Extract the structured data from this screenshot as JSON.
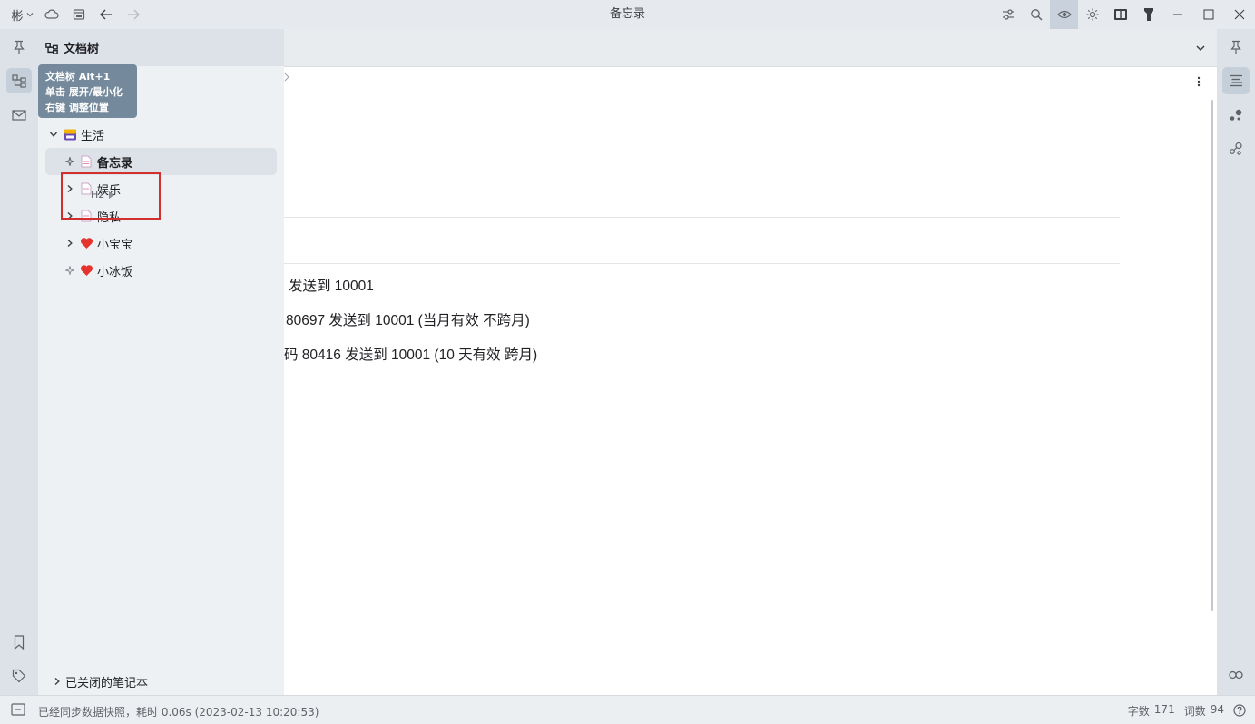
{
  "window": {
    "title": "备忘录",
    "workspace_label": "彬"
  },
  "tree": {
    "header": "文档树",
    "tooltip": [
      "文档树 Alt+1",
      "单击 展开/最小化",
      "右键 调整位置"
    ],
    "items": [
      {
        "label": "生活",
        "icon": "notebook-icon"
      },
      {
        "label": "备忘录",
        "icon": "document-icon",
        "selected": true
      },
      {
        "label": "娱乐",
        "icon": "document-icon"
      },
      {
        "label": "隐私",
        "icon": "document-icon"
      },
      {
        "label": "小宝宝",
        "icon": "heart-icon"
      },
      {
        "label": "小冰饭",
        "icon": "heart-icon"
      }
    ],
    "closed_notebooks": "已关闭的笔记本",
    "drag_hint": "H2"
  },
  "editor": {
    "lines": [
      "发送到 10001",
      "80697 发送到 10001 (当月有效 不跨月)",
      "码 80416 发送到 10001 (10 天有效 跨月)"
    ]
  },
  "status": {
    "message": "已经同步数据快照，耗时 0.06s (2023-02-13 10:20:53)",
    "char_count_label": "字数",
    "char_count": "171",
    "word_count_label": "词数",
    "word_count": "94"
  },
  "colors": {
    "accent": "#6e8497",
    "heart": "#e5342d",
    "highlight_box": "#d22f2f"
  }
}
